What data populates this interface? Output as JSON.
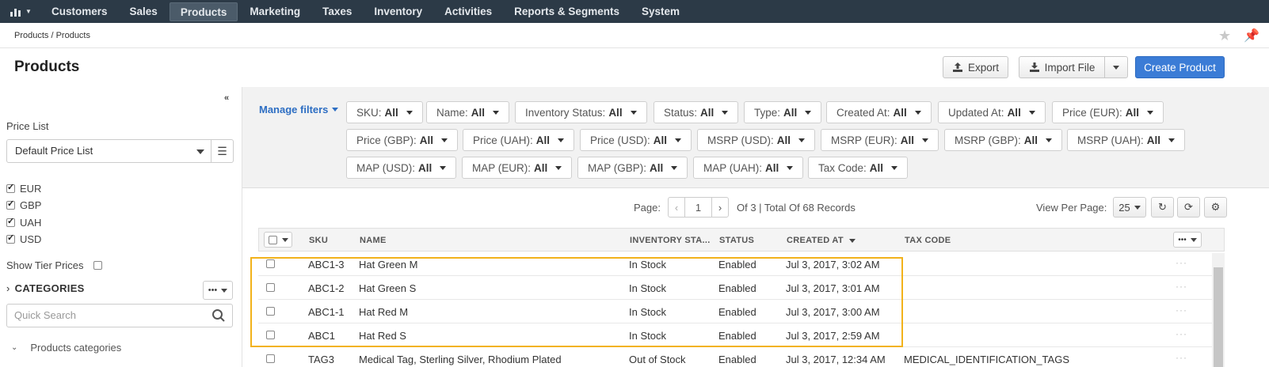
{
  "nav": {
    "items": [
      "Customers",
      "Sales",
      "Products",
      "Marketing",
      "Taxes",
      "Inventory",
      "Activities",
      "Reports & Segments",
      "System"
    ],
    "active": "Products"
  },
  "breadcrumb": "Products / Products",
  "header": {
    "title": "Products",
    "export_label": "Export",
    "import_label": "Import File",
    "create_label": "Create Product"
  },
  "sidebar": {
    "price_list_label": "Price List",
    "price_list_value": "Default Price List",
    "currencies": [
      {
        "code": "EUR",
        "checked": true
      },
      {
        "code": "GBP",
        "checked": true
      },
      {
        "code": "UAH",
        "checked": true
      },
      {
        "code": "USD",
        "checked": true
      }
    ],
    "show_tier_prices": "Show Tier Prices",
    "categories_title": "CATEGORIES",
    "search_placeholder": "Quick Search",
    "tree_root": "Products categories"
  },
  "filters": {
    "manage_label": "Manage filters",
    "chips": [
      {
        "label": "SKU:",
        "value": "All"
      },
      {
        "label": "Name:",
        "value": "All"
      },
      {
        "label": "Inventory Status:",
        "value": "All"
      },
      {
        "label": "Status:",
        "value": "All"
      },
      {
        "label": "Type:",
        "value": "All"
      },
      {
        "label": "Created At:",
        "value": "All"
      },
      {
        "label": "Updated At:",
        "value": "All"
      },
      {
        "label": "Price (EUR):",
        "value": "All"
      },
      {
        "label": "Price (GBP):",
        "value": "All"
      },
      {
        "label": "Price (UAH):",
        "value": "All"
      },
      {
        "label": "Price (USD):",
        "value": "All"
      },
      {
        "label": "MSRP (USD):",
        "value": "All"
      },
      {
        "label": "MSRP (EUR):",
        "value": "All"
      },
      {
        "label": "MSRP (GBP):",
        "value": "All"
      },
      {
        "label": "MSRP (UAH):",
        "value": "All"
      },
      {
        "label": "MAP (USD):",
        "value": "All"
      },
      {
        "label": "MAP (EUR):",
        "value": "All"
      },
      {
        "label": "MAP (GBP):",
        "value": "All"
      },
      {
        "label": "MAP (UAH):",
        "value": "All"
      },
      {
        "label": "Tax Code:",
        "value": "All"
      }
    ]
  },
  "pager": {
    "page_label": "Page:",
    "page": "1",
    "summary": "Of 3 | Total Of 68 Records",
    "view_per_page_label": "View Per Page:",
    "per_page": "25"
  },
  "grid": {
    "columns": [
      "SKU",
      "NAME",
      "INVENTORY STA...",
      "STATUS",
      "CREATED AT",
      "TAX CODE"
    ],
    "rows": [
      {
        "sku": "ABC1-3",
        "name": "Hat Green M",
        "inventory": "In Stock",
        "status": "Enabled",
        "created": "Jul 3, 2017, 3:02 AM",
        "tax": ""
      },
      {
        "sku": "ABC1-2",
        "name": "Hat Green S",
        "inventory": "In Stock",
        "status": "Enabled",
        "created": "Jul 3, 2017, 3:01 AM",
        "tax": ""
      },
      {
        "sku": "ABC1-1",
        "name": "Hat Red M",
        "inventory": "In Stock",
        "status": "Enabled",
        "created": "Jul 3, 2017, 3:00 AM",
        "tax": ""
      },
      {
        "sku": "ABC1",
        "name": "Hat Red S",
        "inventory": "In Stock",
        "status": "Enabled",
        "created": "Jul 3, 2017, 2:59 AM",
        "tax": ""
      },
      {
        "sku": "TAG3",
        "name": "Medical Tag, Sterling Silver, Rhodium Plated",
        "inventory": "Out of Stock",
        "status": "Enabled",
        "created": "Jul 3, 2017, 12:34 AM",
        "tax": "MEDICAL_IDENTIFICATION_TAGS"
      }
    ],
    "row_action": "···"
  },
  "colors": {
    "nav_bg": "#2c3a47",
    "primary": "#3b7cd6",
    "link": "#2d6ec3",
    "highlight": "#f2b21b"
  }
}
